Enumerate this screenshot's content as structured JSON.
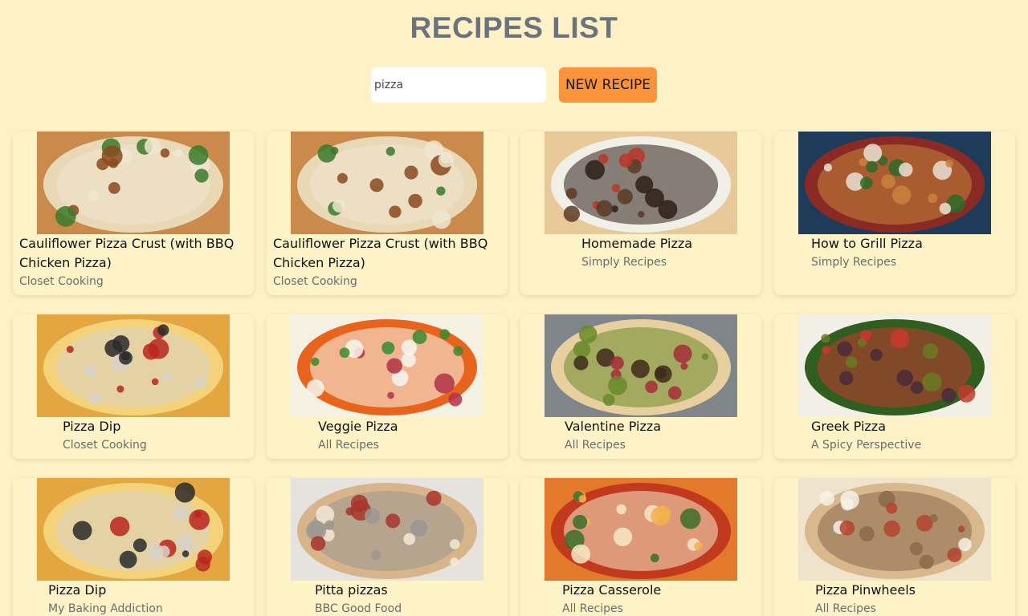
{
  "header": {
    "title": "RECIPES LIST"
  },
  "search": {
    "value": "pizza",
    "placeholder": ""
  },
  "toolbar": {
    "new_recipe_label": "NEW RECIPE"
  },
  "colors": {
    "background": "#fdf1c5",
    "button": "#fb923c",
    "title": "#6b7280"
  },
  "recipes": [
    {
      "name": "Cauliflower Pizza Crust (with BBQ Chicken Pizza)",
      "source": "Closet Cooking",
      "image": "pizza-bbq-chicken-icon"
    },
    {
      "name": "Cauliflower Pizza Crust (with BBQ Chicken Pizza)",
      "source": "Closet Cooking",
      "image": "pizza-bbq-chicken-icon"
    },
    {
      "name": "Homemade Pizza",
      "source": "Simply Recipes",
      "image": "pizza-homemade-icon"
    },
    {
      "name": "How to Grill Pizza",
      "source": "Simply Recipes",
      "image": "pizza-grilled-icon"
    },
    {
      "name": "Pizza Dip",
      "source": "Closet Cooking",
      "image": "pizza-dip-icon"
    },
    {
      "name": "Veggie Pizza",
      "source": "All Recipes",
      "image": "veggie-pizza-icon"
    },
    {
      "name": "Valentine Pizza",
      "source": "All Recipes",
      "image": "valentine-pizza-icon"
    },
    {
      "name": "Greek Pizza",
      "source": "A Spicy Perspective",
      "image": "greek-pizza-icon"
    },
    {
      "name": "Pizza Dip",
      "source": "My Baking Addiction",
      "image": "pizza-dip-icon"
    },
    {
      "name": "Pitta pizzas",
      "source": "BBC Good Food",
      "image": "pitta-pizza-icon"
    },
    {
      "name": "Pizza Casserole",
      "source": "All Recipes",
      "image": "pizza-casserole-icon"
    },
    {
      "name": "Pizza Pinwheels",
      "source": "All Recipes",
      "image": "pizza-pinwheels-icon"
    }
  ]
}
